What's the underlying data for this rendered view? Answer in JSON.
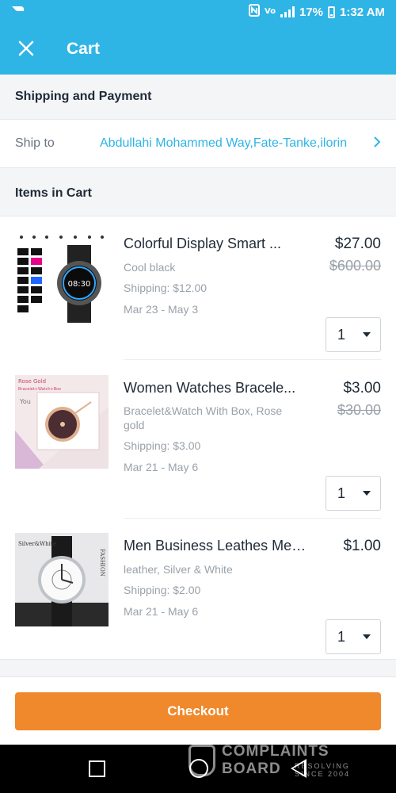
{
  "status_bar": {
    "battery": "17%",
    "time": "1:32 AM"
  },
  "header": {
    "title": "Cart",
    "close_icon": "close-icon"
  },
  "shipping_section": {
    "heading": "Shipping and Payment",
    "ship_to_label": "Ship to",
    "ship_to_value": "Abdullahi Mohammed Way,Fate-Tanke,ilorin"
  },
  "items_section": {
    "heading": "Items in Cart",
    "items": [
      {
        "title": "Colorful Display Smart ...",
        "variant": "Cool black",
        "shipping": "Shipping: $12.00",
        "dates": "Mar 23 - May 3",
        "price": "$27.00",
        "old_price": "$600.00",
        "quantity": "1",
        "thumb_time": "08:30"
      },
      {
        "title": "Women Watches Bracele...",
        "variant": "Bracelet&Watch With Box, Rose gold",
        "shipping": "Shipping: $3.00",
        "dates": "Mar 21 - May 6",
        "price": "$3.00",
        "old_price": "$30.00",
        "quantity": "1",
        "thumb_caption": "Rose Gold",
        "thumb_caption2": "Bracelet+Watch+Box",
        "thumb_you": "You"
      },
      {
        "title": "Men Business Leathes Mes...",
        "variant": "leather, Silver & White",
        "shipping": "Shipping: $2.00",
        "dates": "Mar 21 - May 6",
        "price": "$1.00",
        "old_price": "",
        "quantity": "1",
        "thumb_caption": "Silver&White",
        "thumb_side": "FASHION"
      }
    ]
  },
  "footer": {
    "checkout_label": "Checkout"
  },
  "watermark": {
    "line1": "COMPLAINTS",
    "line2": "BOARD",
    "line3": "RESOLVING SINCE 2004"
  },
  "colors": {
    "accent": "#2fb4e6",
    "checkout": "#f0892c"
  }
}
